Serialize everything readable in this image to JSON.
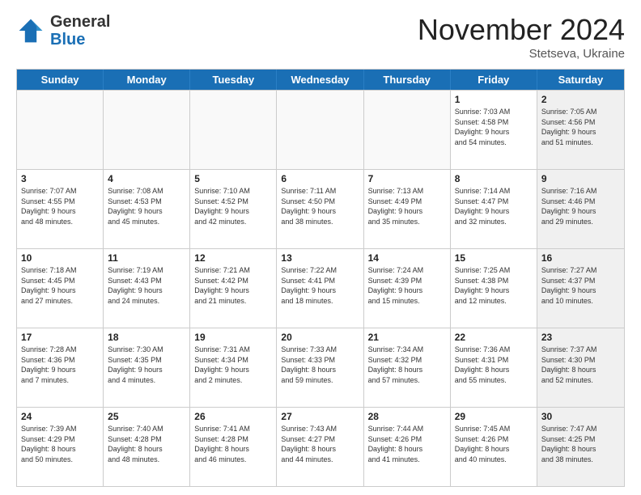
{
  "header": {
    "logo": {
      "general": "General",
      "blue": "Blue"
    },
    "title": "November 2024",
    "subtitle": "Stetseva, Ukraine"
  },
  "weekdays": [
    "Sunday",
    "Monday",
    "Tuesday",
    "Wednesday",
    "Thursday",
    "Friday",
    "Saturday"
  ],
  "rows": [
    [
      {
        "day": "",
        "empty": true,
        "shaded": false,
        "info": ""
      },
      {
        "day": "",
        "empty": true,
        "shaded": false,
        "info": ""
      },
      {
        "day": "",
        "empty": true,
        "shaded": false,
        "info": ""
      },
      {
        "day": "",
        "empty": true,
        "shaded": false,
        "info": ""
      },
      {
        "day": "",
        "empty": true,
        "shaded": false,
        "info": ""
      },
      {
        "day": "1",
        "empty": false,
        "shaded": false,
        "info": "Sunrise: 7:03 AM\nSunset: 4:58 PM\nDaylight: 9 hours\nand 54 minutes."
      },
      {
        "day": "2",
        "empty": false,
        "shaded": true,
        "info": "Sunrise: 7:05 AM\nSunset: 4:56 PM\nDaylight: 9 hours\nand 51 minutes."
      }
    ],
    [
      {
        "day": "3",
        "empty": false,
        "shaded": false,
        "info": "Sunrise: 7:07 AM\nSunset: 4:55 PM\nDaylight: 9 hours\nand 48 minutes."
      },
      {
        "day": "4",
        "empty": false,
        "shaded": false,
        "info": "Sunrise: 7:08 AM\nSunset: 4:53 PM\nDaylight: 9 hours\nand 45 minutes."
      },
      {
        "day": "5",
        "empty": false,
        "shaded": false,
        "info": "Sunrise: 7:10 AM\nSunset: 4:52 PM\nDaylight: 9 hours\nand 42 minutes."
      },
      {
        "day": "6",
        "empty": false,
        "shaded": false,
        "info": "Sunrise: 7:11 AM\nSunset: 4:50 PM\nDaylight: 9 hours\nand 38 minutes."
      },
      {
        "day": "7",
        "empty": false,
        "shaded": false,
        "info": "Sunrise: 7:13 AM\nSunset: 4:49 PM\nDaylight: 9 hours\nand 35 minutes."
      },
      {
        "day": "8",
        "empty": false,
        "shaded": false,
        "info": "Sunrise: 7:14 AM\nSunset: 4:47 PM\nDaylight: 9 hours\nand 32 minutes."
      },
      {
        "day": "9",
        "empty": false,
        "shaded": true,
        "info": "Sunrise: 7:16 AM\nSunset: 4:46 PM\nDaylight: 9 hours\nand 29 minutes."
      }
    ],
    [
      {
        "day": "10",
        "empty": false,
        "shaded": false,
        "info": "Sunrise: 7:18 AM\nSunset: 4:45 PM\nDaylight: 9 hours\nand 27 minutes."
      },
      {
        "day": "11",
        "empty": false,
        "shaded": false,
        "info": "Sunrise: 7:19 AM\nSunset: 4:43 PM\nDaylight: 9 hours\nand 24 minutes."
      },
      {
        "day": "12",
        "empty": false,
        "shaded": false,
        "info": "Sunrise: 7:21 AM\nSunset: 4:42 PM\nDaylight: 9 hours\nand 21 minutes."
      },
      {
        "day": "13",
        "empty": false,
        "shaded": false,
        "info": "Sunrise: 7:22 AM\nSunset: 4:41 PM\nDaylight: 9 hours\nand 18 minutes."
      },
      {
        "day": "14",
        "empty": false,
        "shaded": false,
        "info": "Sunrise: 7:24 AM\nSunset: 4:39 PM\nDaylight: 9 hours\nand 15 minutes."
      },
      {
        "day": "15",
        "empty": false,
        "shaded": false,
        "info": "Sunrise: 7:25 AM\nSunset: 4:38 PM\nDaylight: 9 hours\nand 12 minutes."
      },
      {
        "day": "16",
        "empty": false,
        "shaded": true,
        "info": "Sunrise: 7:27 AM\nSunset: 4:37 PM\nDaylight: 9 hours\nand 10 minutes."
      }
    ],
    [
      {
        "day": "17",
        "empty": false,
        "shaded": false,
        "info": "Sunrise: 7:28 AM\nSunset: 4:36 PM\nDaylight: 9 hours\nand 7 minutes."
      },
      {
        "day": "18",
        "empty": false,
        "shaded": false,
        "info": "Sunrise: 7:30 AM\nSunset: 4:35 PM\nDaylight: 9 hours\nand 4 minutes."
      },
      {
        "day": "19",
        "empty": false,
        "shaded": false,
        "info": "Sunrise: 7:31 AM\nSunset: 4:34 PM\nDaylight: 9 hours\nand 2 minutes."
      },
      {
        "day": "20",
        "empty": false,
        "shaded": false,
        "info": "Sunrise: 7:33 AM\nSunset: 4:33 PM\nDaylight: 8 hours\nand 59 minutes."
      },
      {
        "day": "21",
        "empty": false,
        "shaded": false,
        "info": "Sunrise: 7:34 AM\nSunset: 4:32 PM\nDaylight: 8 hours\nand 57 minutes."
      },
      {
        "day": "22",
        "empty": false,
        "shaded": false,
        "info": "Sunrise: 7:36 AM\nSunset: 4:31 PM\nDaylight: 8 hours\nand 55 minutes."
      },
      {
        "day": "23",
        "empty": false,
        "shaded": true,
        "info": "Sunrise: 7:37 AM\nSunset: 4:30 PM\nDaylight: 8 hours\nand 52 minutes."
      }
    ],
    [
      {
        "day": "24",
        "empty": false,
        "shaded": false,
        "info": "Sunrise: 7:39 AM\nSunset: 4:29 PM\nDaylight: 8 hours\nand 50 minutes."
      },
      {
        "day": "25",
        "empty": false,
        "shaded": false,
        "info": "Sunrise: 7:40 AM\nSunset: 4:28 PM\nDaylight: 8 hours\nand 48 minutes."
      },
      {
        "day": "26",
        "empty": false,
        "shaded": false,
        "info": "Sunrise: 7:41 AM\nSunset: 4:28 PM\nDaylight: 8 hours\nand 46 minutes."
      },
      {
        "day": "27",
        "empty": false,
        "shaded": false,
        "info": "Sunrise: 7:43 AM\nSunset: 4:27 PM\nDaylight: 8 hours\nand 44 minutes."
      },
      {
        "day": "28",
        "empty": false,
        "shaded": false,
        "info": "Sunrise: 7:44 AM\nSunset: 4:26 PM\nDaylight: 8 hours\nand 41 minutes."
      },
      {
        "day": "29",
        "empty": false,
        "shaded": false,
        "info": "Sunrise: 7:45 AM\nSunset: 4:26 PM\nDaylight: 8 hours\nand 40 minutes."
      },
      {
        "day": "30",
        "empty": false,
        "shaded": true,
        "info": "Sunrise: 7:47 AM\nSunset: 4:25 PM\nDaylight: 8 hours\nand 38 minutes."
      }
    ]
  ]
}
